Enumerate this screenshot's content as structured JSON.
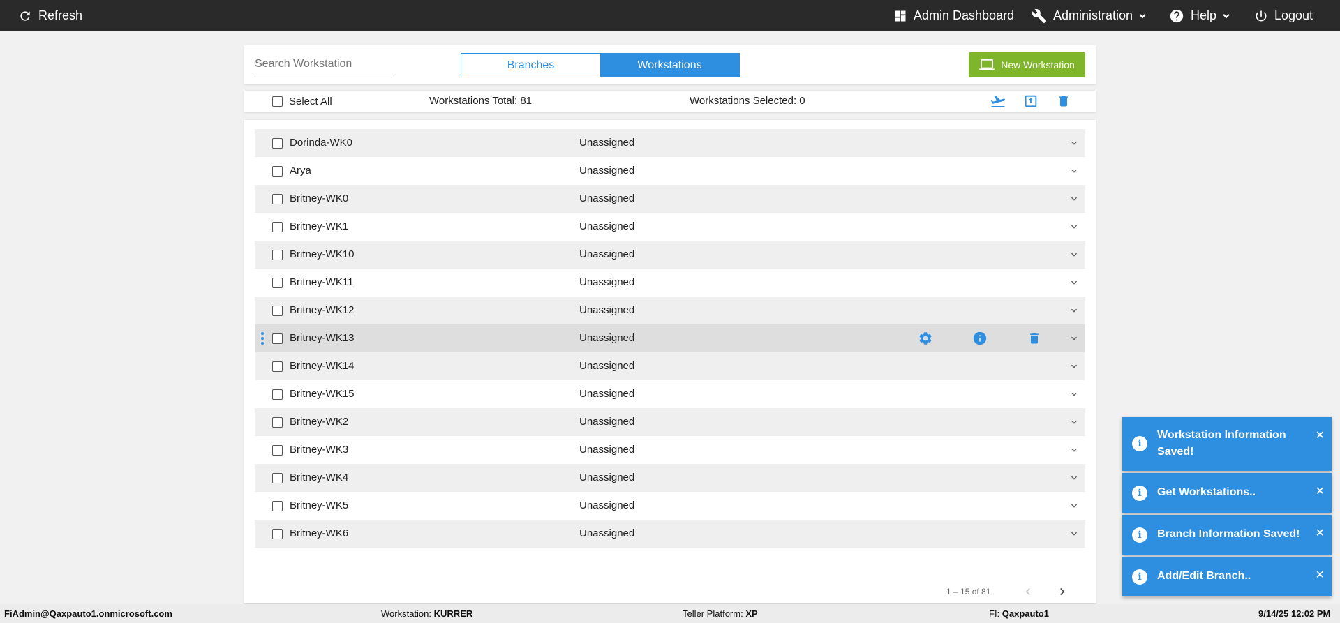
{
  "topbar": {
    "refresh_label": "Refresh",
    "admin_dashboard_label": "Admin Dashboard",
    "administration_label": "Administration",
    "help_label": "Help",
    "logout_label": "Logout"
  },
  "search": {
    "placeholder": "Search Workstation",
    "value": ""
  },
  "tabs": {
    "branches_label": "Branches",
    "workstations_label": "Workstations",
    "active": "Workstations"
  },
  "new_workstation_label": "New Workstation",
  "selection": {
    "select_all_label": "Select All",
    "total_text": "Workstations Total: 81",
    "selected_text": "Workstations Selected: 0"
  },
  "rows": [
    {
      "name": "Dorinda-WK0",
      "status": "Unassigned"
    },
    {
      "name": "Arya",
      "status": "Unassigned"
    },
    {
      "name": "Britney-WK0",
      "status": "Unassigned"
    },
    {
      "name": "Britney-WK1",
      "status": "Unassigned"
    },
    {
      "name": "Britney-WK10",
      "status": "Unassigned"
    },
    {
      "name": "Britney-WK11",
      "status": "Unassigned"
    },
    {
      "name": "Britney-WK12",
      "status": "Unassigned"
    },
    {
      "name": "Britney-WK13",
      "status": "Unassigned"
    },
    {
      "name": "Britney-WK14",
      "status": "Unassigned"
    },
    {
      "name": "Britney-WK15",
      "status": "Unassigned"
    },
    {
      "name": "Britney-WK2",
      "status": "Unassigned"
    },
    {
      "name": "Britney-WK3",
      "status": "Unassigned"
    },
    {
      "name": "Britney-WK4",
      "status": "Unassigned"
    },
    {
      "name": "Britney-WK5",
      "status": "Unassigned"
    },
    {
      "name": "Britney-WK6",
      "status": "Unassigned"
    }
  ],
  "pagination": {
    "range_text": "1 – 15 of 81"
  },
  "statusbar": {
    "user": "FiAdmin@Qaxpauto1.onmicrosoft.com",
    "workstation_label": "Workstation:",
    "workstation_value": "KURRER",
    "teller_label": "Teller Platform:",
    "teller_value": "XP",
    "fi_label": "FI:",
    "fi_value": "Qaxpauto1",
    "datetime": "9/14/25 12:02 PM"
  },
  "toasts": [
    {
      "text": "Workstation Information Saved!"
    },
    {
      "text": "Get Workstations.."
    },
    {
      "text": "Branch Information Saved!"
    },
    {
      "text": "Add/Edit Branch.."
    }
  ],
  "colors": {
    "accent": "#2e8ee0",
    "new_button": "#7fb52a",
    "topbar": "#2a2a2a"
  }
}
